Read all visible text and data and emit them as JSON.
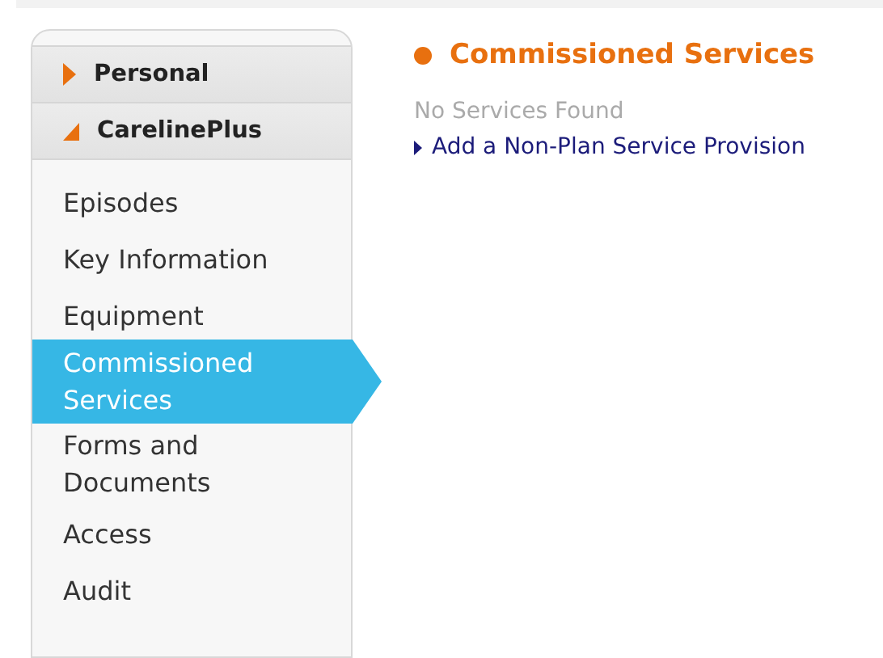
{
  "sidebar": {
    "sections": [
      {
        "label": "Personal",
        "expanded": false
      },
      {
        "label": "CarelinePlus",
        "expanded": true
      }
    ],
    "items": [
      {
        "label": "Episodes",
        "selected": false
      },
      {
        "label": "Key Information",
        "selected": false
      },
      {
        "label": "Equipment",
        "selected": false
      },
      {
        "label": "Commissioned Services",
        "selected": true
      },
      {
        "label": "Forms and Documents",
        "selected": false
      },
      {
        "label": "Access",
        "selected": false
      },
      {
        "label": "Audit",
        "selected": false
      }
    ]
  },
  "content": {
    "title": "Commissioned Services",
    "message": "No Services Found",
    "links": [
      "Add a Non-Plan Service Provision"
    ]
  }
}
